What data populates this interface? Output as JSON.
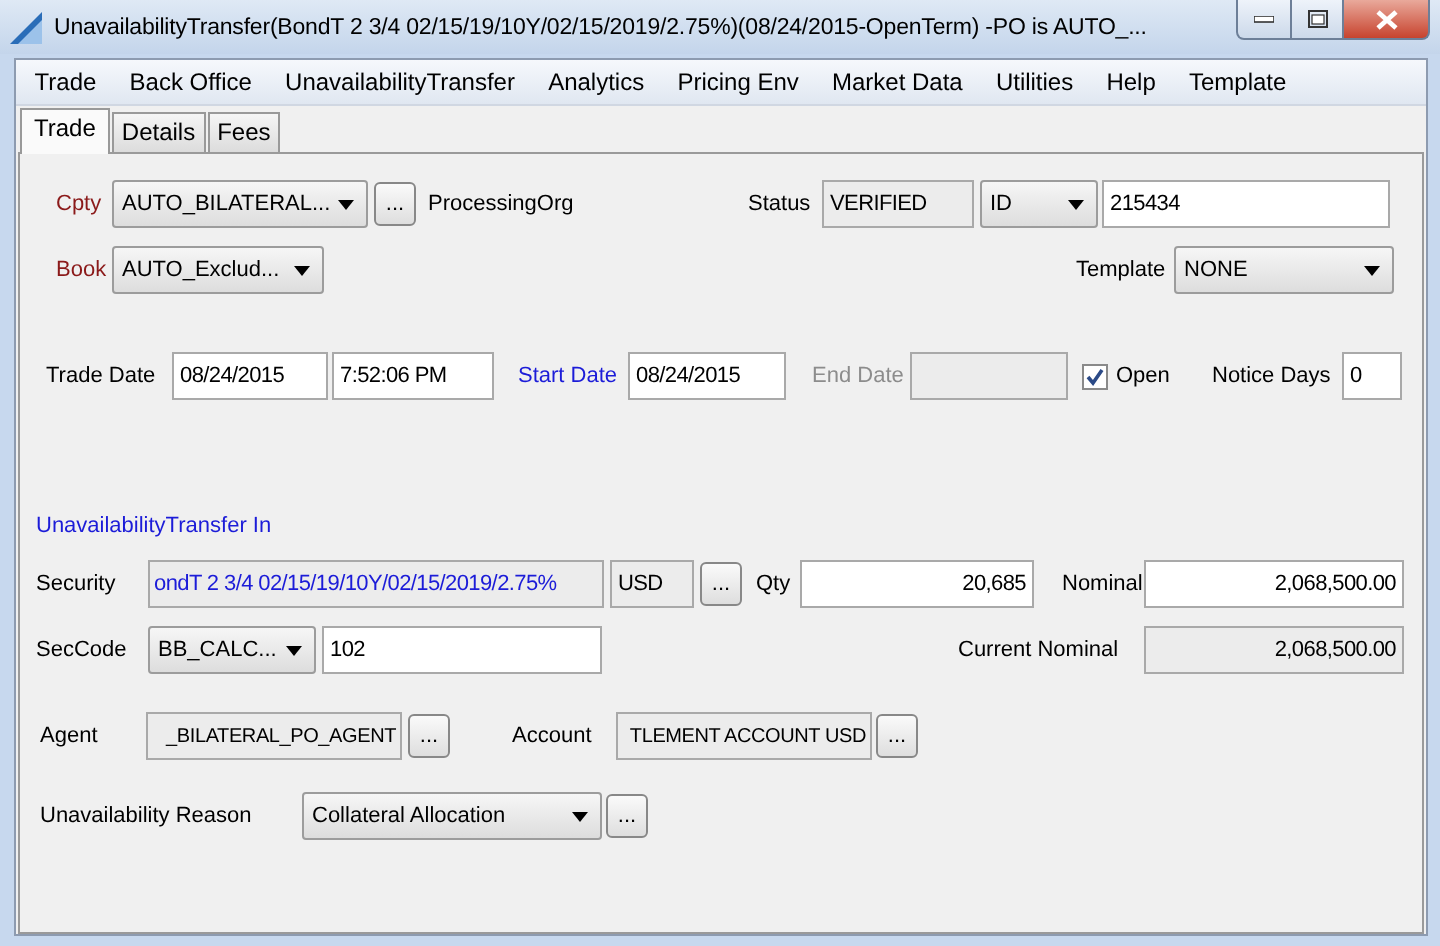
{
  "window": {
    "title": "UnavailabilityTransfer(BondT 2 3/4 02/15/19/10Y/02/15/2019/2.75%)(08/24/2015-OpenTerm)  -PO is AUTO_..."
  },
  "menu": [
    "Trade",
    "Back Office",
    "UnavailabilityTransfer",
    "Analytics",
    "Pricing Env",
    "Market Data",
    "Utilities",
    "Help",
    "Template"
  ],
  "tabs": [
    {
      "label": "Trade",
      "selected": true
    },
    {
      "label": "Details",
      "selected": false
    },
    {
      "label": "Fees",
      "selected": false
    }
  ],
  "cpty": {
    "label": "Cpty",
    "value": "AUTO_BILATERAL...",
    "button": "...",
    "org": "ProcessingOrg"
  },
  "status": {
    "label": "Status",
    "value": "VERIFIED"
  },
  "id": {
    "type": "ID",
    "value": "215434"
  },
  "book": {
    "label": "Book",
    "value": "AUTO_Exclud..."
  },
  "template": {
    "label": "Template",
    "value": "NONE"
  },
  "trade_date": {
    "label": "Trade Date",
    "date": "08/24/2015",
    "time": "7:52:06 PM"
  },
  "start_date": {
    "label": "Start Date",
    "value": "08/24/2015"
  },
  "end_date": {
    "label": "End Date",
    "disabled": true
  },
  "open": {
    "label": "Open",
    "checked": true
  },
  "notice_days": {
    "label": "Notice Days",
    "value": "0"
  },
  "section_title": "UnavailabilityTransfer In",
  "security": {
    "label": "Security",
    "value": "ondT 2 3/4 02/15/19/10Y/02/15/2019/2.75%",
    "currency": "USD",
    "button": "..."
  },
  "qty": {
    "label": "Qty",
    "value": "20,685"
  },
  "nominal": {
    "label": "Nominal",
    "value": "2,068,500.00"
  },
  "sec_code": {
    "label": "SecCode",
    "type": "BB_CALC...",
    "value": "102"
  },
  "current_nominal": {
    "label": "Current Nominal",
    "value": "2,068,500.00"
  },
  "agent": {
    "label": "Agent",
    "value": "_BILATERAL_PO_AGENT",
    "button": "..."
  },
  "account": {
    "label": "Account",
    "value": "TLEMENT ACCOUNT USD",
    "button": "..."
  },
  "reason": {
    "label": "Unavailability Reason",
    "value": "Collateral Allocation",
    "button": "..."
  }
}
